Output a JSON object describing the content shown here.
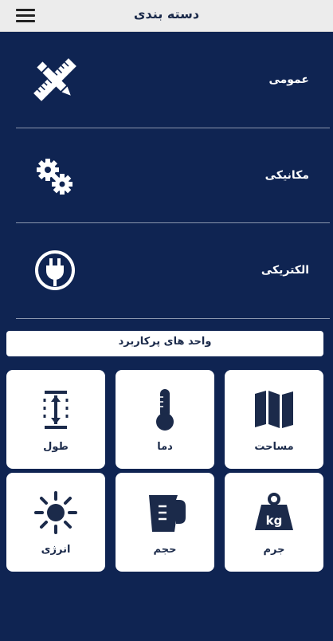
{
  "header": {
    "title": "دسته بندی",
    "menu_icon": "hamburger-menu-icon"
  },
  "categories": [
    {
      "label": "عمومی",
      "icon": "ruler-pencil-icon"
    },
    {
      "label": "مکانیکی",
      "icon": "gears-icon"
    },
    {
      "label": "الکتریکی",
      "icon": "power-plug-icon"
    }
  ],
  "units_section": {
    "title": "واحد های پرکاربرد"
  },
  "units": [
    {
      "label": "مساحت",
      "icon": "map-icon"
    },
    {
      "label": "دما",
      "icon": "thermometer-icon"
    },
    {
      "label": "طول",
      "icon": "length-icon"
    },
    {
      "label": "جرم",
      "icon": "weight-kg-icon",
      "icon_text": "kg"
    },
    {
      "label": "حجم",
      "icon": "measuring-cup-icon"
    },
    {
      "label": "انرژی",
      "icon": "sun-icon"
    }
  ],
  "colors": {
    "background": "#0f2452",
    "header_bg": "#ececec",
    "tile_bg": "#ffffff",
    "icon_dark": "#1b2a4a"
  }
}
